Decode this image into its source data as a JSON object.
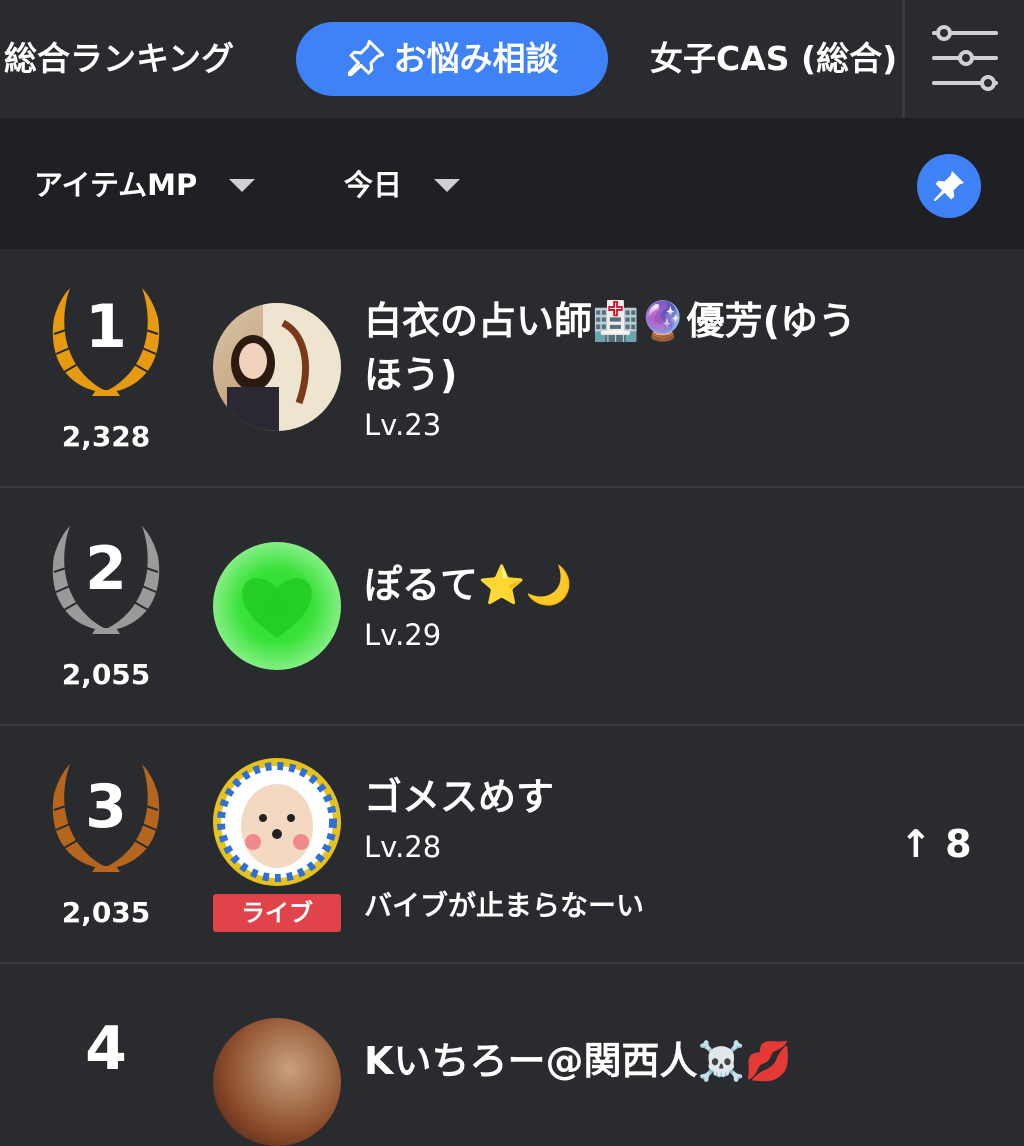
{
  "tabs": [
    {
      "label": "総合ランキング"
    },
    {
      "label": "お悩み相談"
    },
    {
      "label": "女子CAS (総合)"
    }
  ],
  "filters": {
    "metric": "アイテムMP",
    "period": "今日"
  },
  "ranking": [
    {
      "rank": "1",
      "points": "2,328",
      "name": "白衣の占い師🏥🔮優芳(ゆうほう)",
      "level": "Lv.23",
      "medal": "gold"
    },
    {
      "rank": "2",
      "points": "2,055",
      "name": "ぽるて⭐🌙",
      "level": "Lv.29",
      "medal": "silver"
    },
    {
      "rank": "3",
      "points": "2,035",
      "name": "ゴメスめす",
      "level": "Lv.28",
      "comment": "バイブが止まらなーい",
      "badge": "ライブ",
      "change": "↑ 8",
      "medal": "bronze"
    },
    {
      "rank": "4",
      "name": "Kいちろー@関西人☠️💋"
    }
  ],
  "colors": {
    "accent": "#3f82f7",
    "gold": "#e59a12",
    "silver": "#9a9a9a",
    "bronze": "#b5651d",
    "live": "#e0434a"
  },
  "icons": {
    "tab_pin": "pin-icon",
    "filter": "sliders-icon",
    "pin_button": "pin-icon",
    "dropdown": "caret-down-icon"
  }
}
